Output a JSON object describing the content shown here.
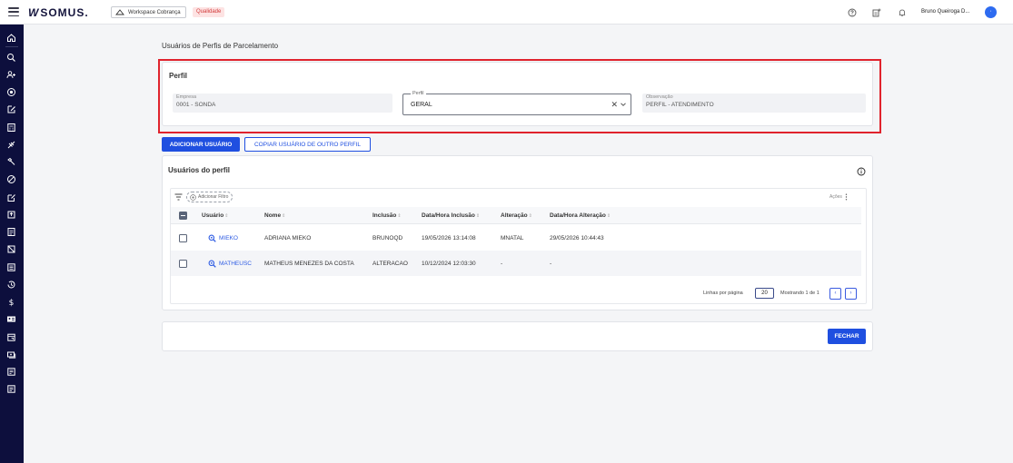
{
  "app": {
    "logo": "SOMUS.",
    "workspace": "Workspace Cobrança",
    "environment_badge": "Qualidade",
    "user_name": "Bruno Queiroga D...",
    "avatar_initial": "·",
    "icons": {
      "menu": "hamburger-icon",
      "help": "help-circle-icon",
      "apps": "grid-plus-icon",
      "notifications": "bell-icon"
    }
  },
  "sidebar": {
    "items": [
      "home-icon",
      "search-icon",
      "users-icon",
      "target-icon",
      "edit-icon",
      "calculator-icon",
      "link-off-icon",
      "tools-icon",
      "block-icon",
      "edit-box-icon",
      "export-icon",
      "document-icon",
      "ban-doc-icon",
      "list-icon",
      "history-icon",
      "dollar-icon",
      "id-card-icon",
      "calendar-icon",
      "cash-icon",
      "note-icon",
      "note-alt-icon"
    ]
  },
  "page": {
    "title": "Usuários de Perfis de Parcelamento"
  },
  "profile": {
    "title": "Perfil",
    "company_label": "Empresa",
    "company_value": "0001 - SONDA",
    "profile_label": "Perfil",
    "profile_value": "GERAL",
    "notes_label": "Observação",
    "notes_value": "PERFIL - ATENDIMENTO"
  },
  "actions": {
    "add_user": "ADICIONAR USUÁRIO",
    "copy_user": "COPIAR USUÁRIO DE OUTRO PERFIL"
  },
  "users": {
    "title": "Usuários do perfil",
    "add_filter": "Adicionar Filtro",
    "actions_label": "Ações",
    "columns": [
      "Usuário",
      "Nome",
      "Inclusão",
      "Data/Hora Inclusão",
      "Alteração",
      "Data/Hora Alteração"
    ],
    "rows": [
      {
        "user": "MIEKO",
        "name": "ADRIANA MIEKO",
        "inclusion": "BRUNOQD",
        "inclusion_dt": "19/05/2026 13:14:08",
        "change": "MNATAL",
        "change_dt": "29/05/2026 10:44:43"
      },
      {
        "user": "MATHEUSC",
        "name": "MATHEUS MENEZES DA COSTA",
        "inclusion": "ALTERACAO",
        "inclusion_dt": "10/12/2024 12:03:30",
        "change": "-",
        "change_dt": "-"
      }
    ],
    "rows_per_page_label": "Linhas por página",
    "rows_per_page": "20",
    "showing": "Mostrando 1 de 1",
    "prev": "‹",
    "next": "›"
  },
  "footer": {
    "close": "FECHAR"
  },
  "colors": {
    "primary": "#1f4fe0",
    "sidebar": "#0d0f3d",
    "highlight": "#e0232d",
    "badge_bg": "#fde3e3",
    "badge_text": "#d23a3a"
  }
}
